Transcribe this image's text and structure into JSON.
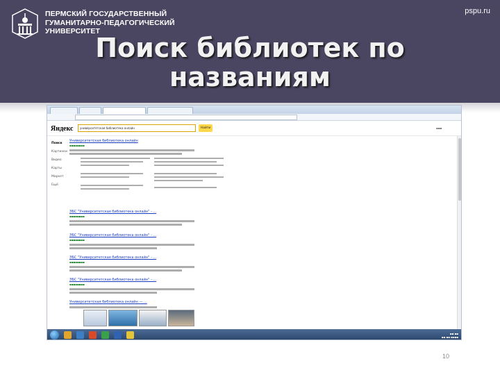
{
  "header": {
    "university_lines": [
      "ПЕРМСКИЙ ГОСУДАРСТВЕННЫЙ",
      "ГУМАНИТАРНО-ПЕДАГОГИЧЕСКИЙ",
      "УНИВЕРСИТЕТ"
    ],
    "site": "pspu.ru",
    "title_lines": [
      "Поиск библиотек по",
      "названиям"
    ]
  },
  "browser": {
    "search_engine": "Яндекс",
    "search_button": "Найти",
    "search_query": "университетская библиотека онлайн",
    "left_nav": [
      "Поиск",
      "Картинки",
      "Видео",
      "Карты",
      "Маркет",
      "Ещё"
    ],
    "results": [
      {
        "title": "Университетская библиотека онлайн"
      },
      {
        "title": "ЭБС \"Университетская библиотека онлайн\" - ..."
      },
      {
        "title": "ЭБС \"Университетская библиотека онлайн\" - ..."
      },
      {
        "title": "ЭБС \"Университетская библиотека онлайн\" - ..."
      },
      {
        "title": "ЭБС \"Университетская библиотека онлайн\" - ..."
      },
      {
        "title": "Университетская библиотека онлайн — ..."
      }
    ]
  },
  "colors": {
    "header_bg": "#4a4560",
    "title": "#f2f2f2",
    "link": "#1a3dc1",
    "url": "#0a7a1a",
    "search_button": "#ffd74a"
  },
  "page_number": "10"
}
